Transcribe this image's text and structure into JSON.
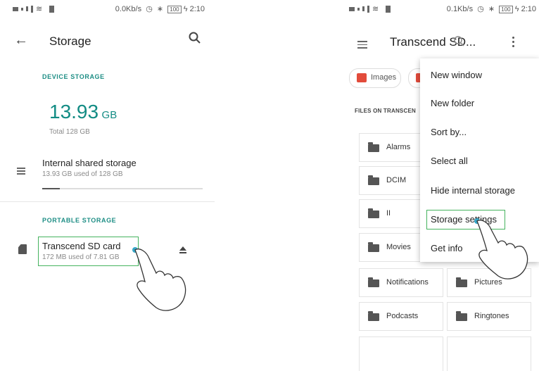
{
  "left_screen": {
    "status": {
      "network": "0.0Kb/s",
      "battery": "100",
      "time": "2:10"
    },
    "header": {
      "title": "Storage",
      "back_icon": "back-arrow-icon",
      "search_icon": "search-icon"
    },
    "device_storage": {
      "section_label": "DEVICE STORAGE",
      "used_value": "13.93",
      "used_unit": "GB",
      "total_label": "Total 128 GB",
      "internal": {
        "title": "Internal shared storage",
        "subtitle": "13.93 GB used of 128 GB",
        "used_fraction": 0.109
      }
    },
    "portable_storage": {
      "section_label": "PORTABLE STORAGE",
      "sd_card": {
        "title": "Transcend SD card",
        "subtitle": "172 MB used of 7.81 GB"
      }
    }
  },
  "right_screen": {
    "status": {
      "network": "0.1Kb/s",
      "battery": "100",
      "time": "2:10"
    },
    "header": {
      "title": "Transcend SD...",
      "menu_icon": "hamburger-menu-icon",
      "search_icon": "search-icon",
      "more_icon": "more-vert-icon"
    },
    "chips": [
      {
        "label": "Images",
        "icon": "image-icon"
      }
    ],
    "files_label": "FILES ON TRANSCEN",
    "folders": [
      "Alarms",
      "DCIM",
      "II",
      "Movies",
      "Notifications",
      "Pictures",
      "Podcasts",
      "Ringtones"
    ],
    "menu": {
      "items": [
        "New window",
        "New folder",
        "Sort by...",
        "Select all",
        "Hide internal storage",
        "Storage settings",
        "Get info"
      ],
      "highlighted": "Storage settings"
    }
  },
  "colors": {
    "accent": "#138c84",
    "highlight_box": "#45b35e"
  }
}
